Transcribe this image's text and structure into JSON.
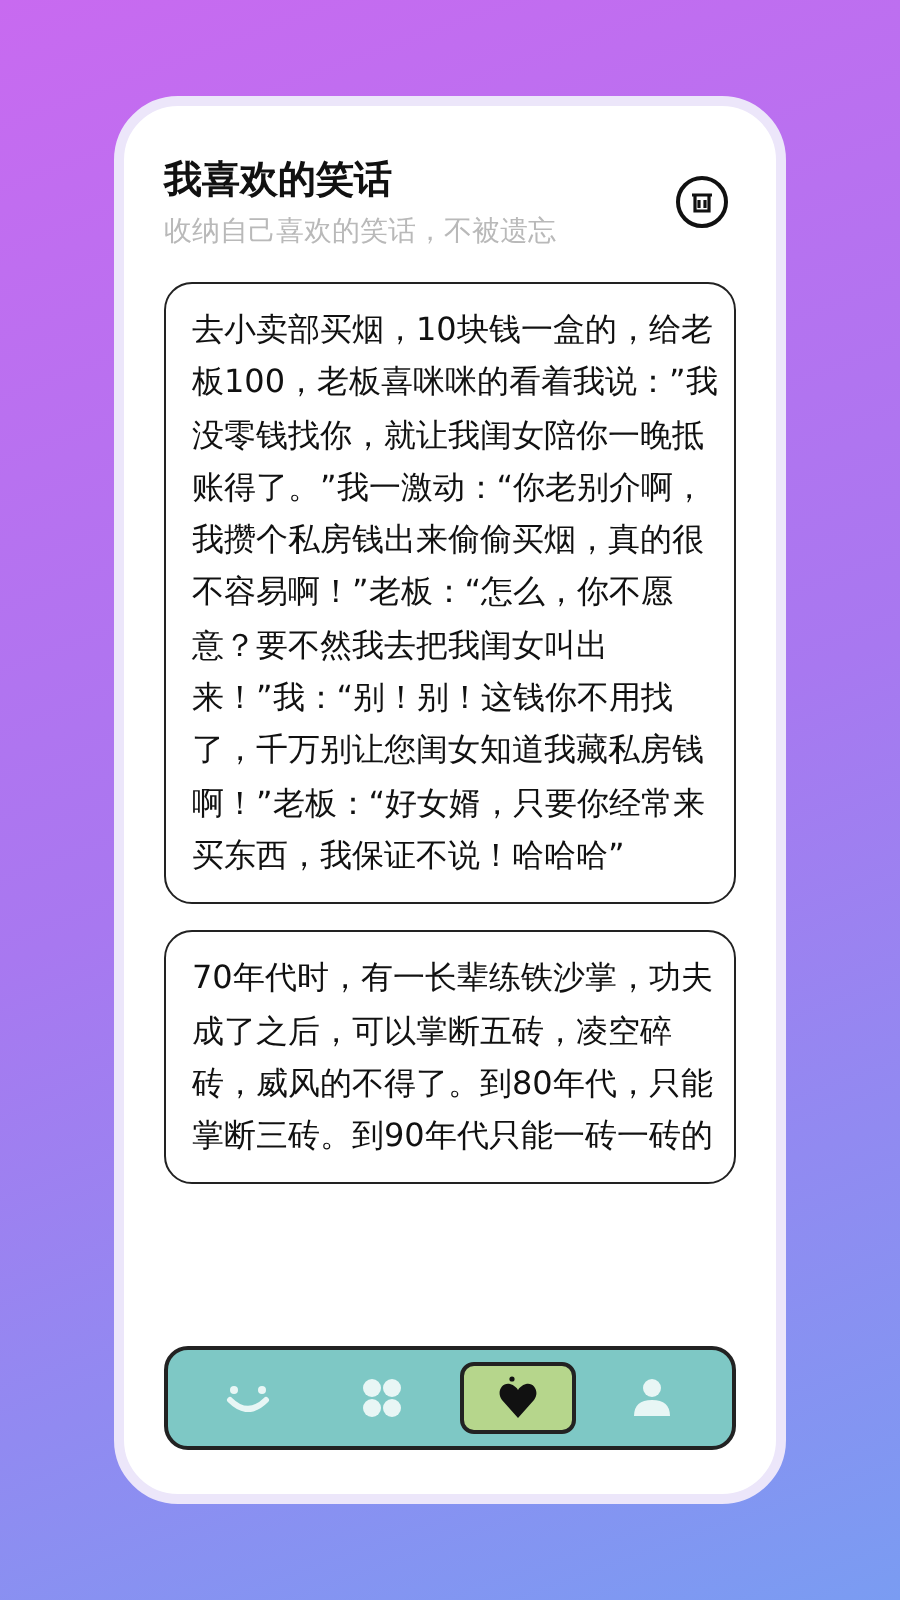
{
  "header": {
    "title": "我喜欢的笑话",
    "subtitle": "收纳自己喜欢的笑话，不被遗忘"
  },
  "jokes": [
    {
      "text": "去小卖部买烟，10块钱一盒的，给老板100，老板喜咪咪的看着我说：”我没零钱找你，就让我闺女陪你一晚抵账得了。”我一激动：“你老别介啊，我攒个私房钱出来偷偷买烟，真的很不容易啊！”老板：“怎么，你不愿意？要不然我去把我闺女叫出来！”我：“别！别！这钱你不用找了，千万别让您闺女知道我藏私房钱啊！”老板：“好女婿，只要你经常来买东西，我保证不说！哈哈哈”"
    },
    {
      "text": "70年代时，有一长辈练铁沙掌，功夫成了之后，可以掌断五砖，凌空碎砖，威风的不得了。到80年代，只能掌断三砖。到90年代只能一砖一砖的"
    }
  ],
  "nav": [
    {
      "kind": "smile",
      "selected": false
    },
    {
      "kind": "grid",
      "selected": false
    },
    {
      "kind": "heart",
      "selected": true
    },
    {
      "kind": "person",
      "selected": false
    }
  ]
}
